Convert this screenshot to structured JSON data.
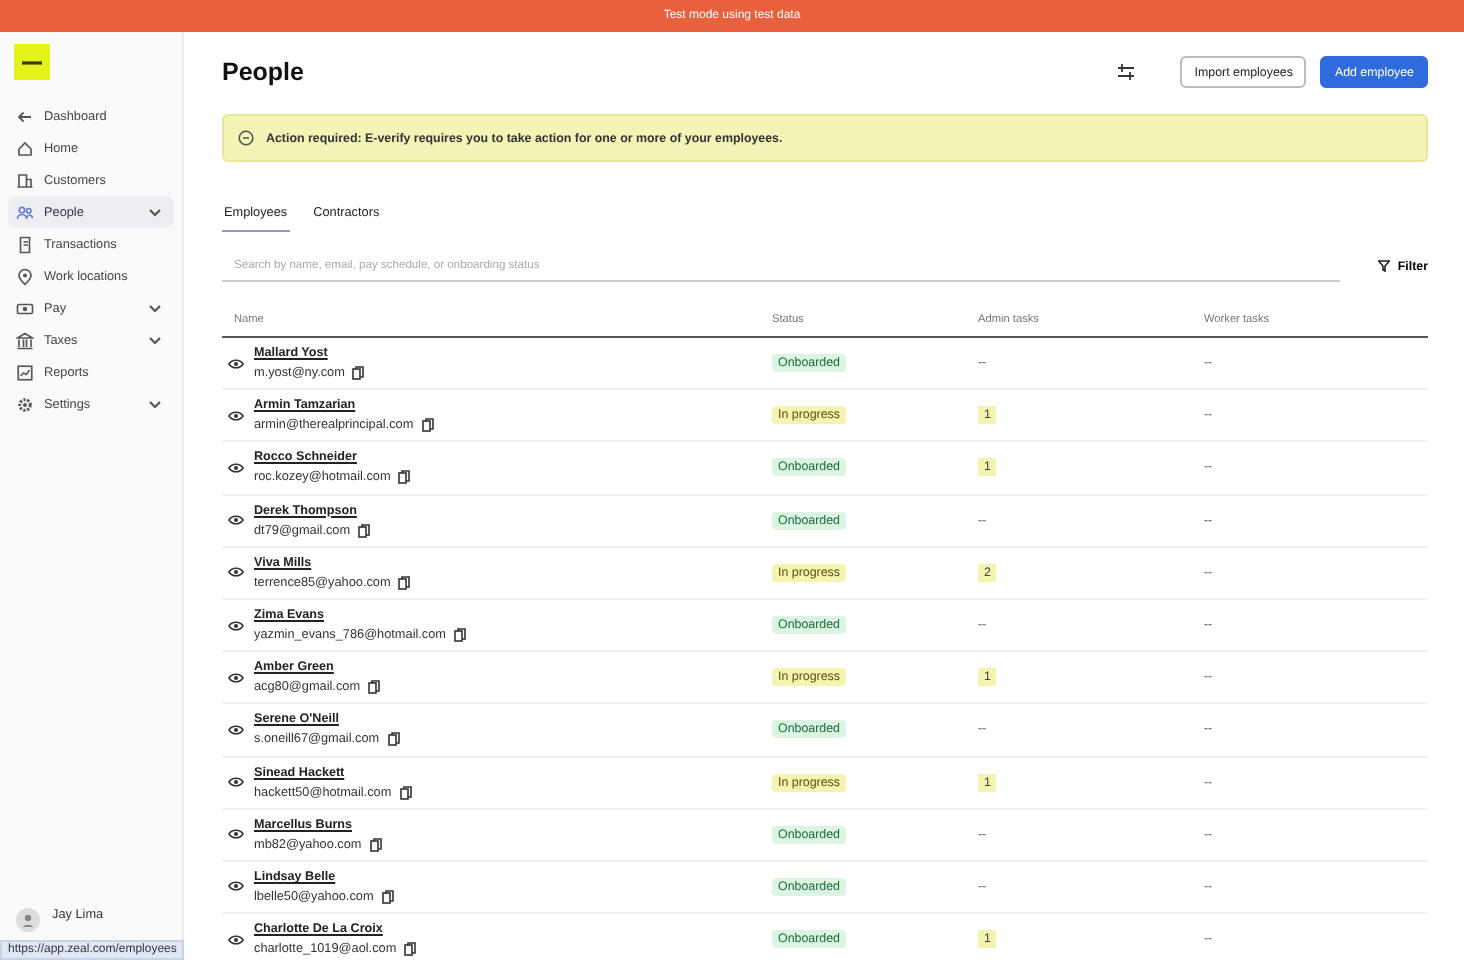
{
  "banner": {
    "text": "Test mode using test data"
  },
  "sidebar": {
    "items": [
      {
        "label": "Dashboard",
        "selected": false,
        "expandable": false
      },
      {
        "label": "Home",
        "selected": false,
        "expandable": false
      },
      {
        "label": "Customers",
        "selected": false,
        "expandable": false
      },
      {
        "label": "People",
        "selected": true,
        "expandable": true
      },
      {
        "label": "Transactions",
        "selected": false,
        "expandable": false
      },
      {
        "label": "Work locations",
        "selected": false,
        "expandable": false
      },
      {
        "label": "Pay",
        "selected": false,
        "expandable": true
      },
      {
        "label": "Taxes",
        "selected": false,
        "expandable": true
      },
      {
        "label": "Reports",
        "selected": false,
        "expandable": false
      },
      {
        "label": "Settings",
        "selected": false,
        "expandable": true
      }
    ],
    "user": {
      "name": "Jay Lima"
    }
  },
  "page": {
    "title": "People",
    "buttons": [
      {
        "label": "Import employees",
        "kind": "secondary"
      },
      {
        "label": "Add employee",
        "kind": "primary"
      }
    ],
    "alert": "Action required: E-verify requires you to take action for one or more of your employees.",
    "tabs": [
      {
        "label": "Employees",
        "selected": true
      },
      {
        "label": "Contractors",
        "selected": false
      }
    ],
    "search": {
      "placeholder": "Search by name, email, pay schedule, or onboarding status"
    },
    "filter": "Filter"
  },
  "table": {
    "columns": [
      "Name",
      "Status",
      "Admin tasks",
      "Worker tasks"
    ],
    "rows": [
      {
        "name": "Mallard Yost",
        "email": "m.yost@ny.com",
        "status": "Onboarded",
        "kind": "onboarded",
        "admin_tasks": "--",
        "admin_badge": false,
        "worker_tasks": "--"
      },
      {
        "name": "Armin Tamzarian",
        "email": "armin@therealprincipal.com",
        "status": "In progress",
        "kind": "in_progress",
        "admin_tasks": "1",
        "admin_badge": true,
        "worker_tasks": "--"
      },
      {
        "name": "Rocco Schneider",
        "email": "roc.kozey@hotmail.com",
        "status": "Onboarded",
        "kind": "onboarded",
        "admin_tasks": "1",
        "admin_badge": true,
        "worker_tasks": "--"
      },
      {
        "name": "Derek Thompson",
        "email": "dt79@gmail.com",
        "status": "Onboarded",
        "kind": "onboarded",
        "admin_tasks": "--",
        "admin_badge": false,
        "worker_tasks": "--"
      },
      {
        "name": "Viva Mills",
        "email": "terrence85@yahoo.com",
        "status": "In progress",
        "kind": "in_progress",
        "admin_tasks": "2",
        "admin_badge": true,
        "worker_tasks": "--"
      },
      {
        "name": "Zima Evans",
        "email": "yazmin_evans_786@hotmail.com",
        "status": "Onboarded",
        "kind": "onboarded",
        "admin_tasks": "--",
        "admin_badge": false,
        "worker_tasks": "--"
      },
      {
        "name": "Amber Green",
        "email": "acg80@gmail.com",
        "status": "In progress",
        "kind": "in_progress",
        "admin_tasks": "1",
        "admin_badge": true,
        "worker_tasks": "--"
      },
      {
        "name": "Serene O'Neill",
        "email": "s.oneill67@gmail.com",
        "status": "Onboarded",
        "kind": "onboarded",
        "admin_tasks": "--",
        "admin_badge": false,
        "worker_tasks": "--"
      },
      {
        "name": "Sinead Hackett",
        "email": "hackett50@hotmail.com",
        "status": "In progress",
        "kind": "in_progress",
        "admin_tasks": "1",
        "admin_badge": true,
        "worker_tasks": "--"
      },
      {
        "name": "Marcellus Burns",
        "email": "mb82@yahoo.com",
        "status": "Onboarded",
        "kind": "onboarded",
        "admin_tasks": "--",
        "admin_badge": false,
        "worker_tasks": "--"
      },
      {
        "name": "Lindsay Belle",
        "email": "lbelle50@yahoo.com",
        "status": "Onboarded",
        "kind": "onboarded",
        "admin_tasks": "--",
        "admin_badge": false,
        "worker_tasks": "--"
      },
      {
        "name": "Charlotte De La Croix",
        "email": "charlotte_1019@aol.com",
        "status": "Onboarded",
        "kind": "onboarded",
        "admin_tasks": "1",
        "admin_badge": true,
        "worker_tasks": "--"
      }
    ]
  },
  "status_url": "https://app.zeal.com/employees"
}
